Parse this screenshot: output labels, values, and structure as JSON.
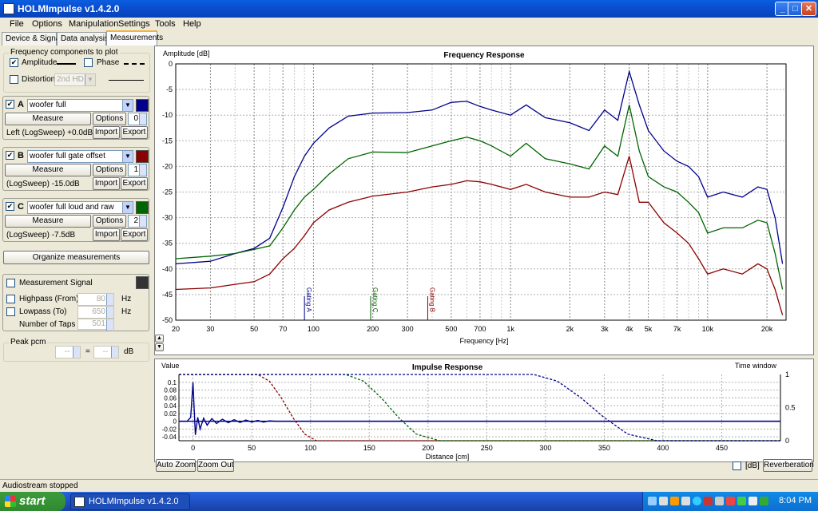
{
  "window": {
    "title": "HOLMImpulse  v1.4.2.0",
    "buttons": {
      "minimize": "_",
      "maximize": "□",
      "close": "✕"
    }
  },
  "menu": [
    "File",
    "Options",
    "Manipulation",
    "Settings",
    "Tools",
    "Help"
  ],
  "tabs": [
    {
      "label": "Device & Signal",
      "active": false
    },
    {
      "label": "Data analysis",
      "active": false
    },
    {
      "label": "Measurements",
      "active": true
    }
  ],
  "freq_components": {
    "group_label": "Frequency components to plot",
    "amplitude": {
      "label": "Amplitude",
      "checked": true
    },
    "phase": {
      "label": "Phase",
      "checked": false
    },
    "distortion": {
      "label": "Distortion",
      "checked": false,
      "select": "2nd HD"
    }
  },
  "measurements": [
    {
      "letter": "A",
      "checked": true,
      "name": "woofer full",
      "color": "#00008b",
      "measure": "Measure",
      "options": "Options",
      "spin": "0",
      "info": "Left (LogSweep) +0.0dB",
      "import": "Import",
      "export": "Export"
    },
    {
      "letter": "B",
      "checked": true,
      "name": "woofer full gate offset",
      "color": "#8b0000",
      "measure": "Measure",
      "options": "Options",
      "spin": "1",
      "info": "(LogSweep) -15.0dB",
      "import": "Import",
      "export": "Export"
    },
    {
      "letter": "C",
      "checked": true,
      "name": "woofer full loud and raw",
      "color": "#006400",
      "measure": "Measure",
      "options": "Options",
      "spin": "2",
      "info": "(LogSweep) -7.5dB",
      "import": "Import",
      "export": "Export"
    }
  ],
  "organize_button": "Organize measurements",
  "measurement_signal": {
    "label": "Measurement Signal",
    "checked": false,
    "highpass": {
      "label": "Highpass (From)",
      "value": "80",
      "unit": "Hz"
    },
    "lowpass": {
      "label": "Lowpass (To)",
      "value": "650",
      "unit": "Hz"
    },
    "taps": {
      "label": "Number of Taps",
      "value": "501"
    }
  },
  "peak": {
    "label": "Peak pcm",
    "left": "--",
    "equals": "=",
    "right": "--",
    "unit": "dB"
  },
  "chart_data": [
    {
      "type": "line",
      "title": "Frequency Response",
      "ylabel": "Amplitude [dB]",
      "xlabel": "Frequency [Hz]",
      "xscale": "log",
      "xlim": [
        20,
        25000
      ],
      "ylim": [
        -50,
        0
      ],
      "grid": true,
      "x_ticks": [
        20,
        30,
        50,
        70,
        100,
        200,
        300,
        500,
        700,
        1000,
        2000,
        3000,
        4000,
        5000,
        7000,
        10000,
        20000
      ],
      "x_tick_labels": [
        "20",
        "30",
        "50",
        "70",
        "100",
        "200",
        "300",
        "500",
        "700",
        "1k",
        "2k",
        "3k",
        "4k",
        "5k",
        "7k",
        "10k",
        "20k"
      ],
      "y_ticks": [
        0,
        -5,
        -10,
        -15,
        -20,
        -25,
        -30,
        -35,
        -40,
        -45,
        -50
      ],
      "markers": [
        {
          "x": 90,
          "label": "Gating A",
          "color": "#00008b"
        },
        {
          "x": 195,
          "label": "Gating C",
          "color": "#006400"
        },
        {
          "x": 380,
          "label": "Gating B",
          "color": "#8b0000"
        }
      ],
      "x": [
        20,
        30,
        40,
        50,
        60,
        70,
        80,
        90,
        100,
        120,
        150,
        200,
        300,
        400,
        500,
        600,
        700,
        800,
        1000,
        1200,
        1500,
        2000,
        2500,
        3000,
        3500,
        4000,
        4500,
        5000,
        6000,
        7000,
        8000,
        9000,
        10000,
        12000,
        15000,
        18000,
        20000,
        22000,
        24000
      ],
      "series": [
        {
          "name": "A",
          "color": "#00008b",
          "values": [
            -39,
            -38.5,
            -37,
            -36,
            -34,
            -28,
            -22,
            -18,
            -15.5,
            -12.5,
            -10.2,
            -9.6,
            -9.5,
            -9.0,
            -7.5,
            -7.3,
            -8.3,
            -9.0,
            -10.0,
            -8.0,
            -10.5,
            -11.5,
            -13,
            -9,
            -11,
            -1.5,
            -8,
            -13,
            -17,
            -19,
            -20,
            -22,
            -26,
            -25,
            -26,
            -24,
            -24.5,
            -30,
            -39
          ]
        },
        {
          "name": "B",
          "color": "#8b0000",
          "values": [
            -44,
            -43.7,
            -43,
            -42.5,
            -41,
            -38,
            -36,
            -33.5,
            -31,
            -28.5,
            -27,
            -25.8,
            -25,
            -24,
            -23.5,
            -22.8,
            -23.0,
            -23.5,
            -24.5,
            -23.5,
            -25,
            -26,
            -26,
            -25,
            -25.5,
            -18,
            -27,
            -27,
            -31,
            -33,
            -35,
            -38,
            -41,
            -40,
            -41,
            -39,
            -40,
            -44,
            -49
          ]
        },
        {
          "name": "C",
          "color": "#006400",
          "values": [
            -38,
            -37.5,
            -37,
            -36.2,
            -35.5,
            -32,
            -28.5,
            -26,
            -24.5,
            -21.5,
            -18.5,
            -17.2,
            -17.3,
            -16,
            -15,
            -14.3,
            -15,
            -16,
            -18,
            -15.5,
            -18.5,
            -19.5,
            -20.5,
            -16,
            -18,
            -8,
            -17,
            -22,
            -24,
            -25,
            -27,
            -29,
            -33,
            -32,
            -32,
            -30.5,
            -31,
            -37,
            -44
          ]
        }
      ]
    },
    {
      "type": "line",
      "title": "Impulse Response",
      "ylabel": "Value",
      "y2label": "Time window",
      "xlabel": "Distance [cm]",
      "xlim": [
        -12,
        500
      ],
      "ylim": [
        -0.05,
        0.12
      ],
      "y2lim": [
        0,
        1
      ],
      "grid": true,
      "x_ticks": [
        0,
        50,
        100,
        150,
        200,
        250,
        300,
        350,
        400,
        450
      ],
      "y_ticks": [
        0.1,
        0.08,
        0.06,
        0.04,
        0.02,
        0,
        -0.02,
        -0.04
      ],
      "y_tick_labels": [
        "0.1",
        "0.08",
        "0.06",
        "0.04",
        "0.02",
        "0",
        "-0.02",
        "-0.04"
      ],
      "y2_ticks": [
        1,
        0.5,
        0
      ],
      "impulse": {
        "x": [
          -12,
          -5,
          -2,
          0,
          1,
          2,
          4,
          6,
          9,
          12,
          16,
          20,
          25,
          30,
          35,
          40,
          45,
          50,
          55,
          60,
          65,
          70,
          80,
          90,
          100,
          200,
          300,
          400,
          480,
          500
        ],
        "values": [
          0,
          0,
          0.01,
          0.1,
          0.03,
          -0.035,
          0.01,
          -0.02,
          0.008,
          -0.01,
          0.007,
          -0.006,
          0.005,
          -0.004,
          0.004,
          -0.003,
          0.003,
          -0.002,
          0.002,
          -0.002,
          0.001,
          0,
          0,
          0,
          0,
          0,
          0,
          0,
          0,
          0
        ]
      },
      "windows": [
        {
          "name": "B",
          "color": "#8b0000",
          "x": [
            -12,
            55,
            65,
            75,
            85,
            95,
            105,
            500
          ],
          "values": [
            1,
            1,
            0.9,
            0.65,
            0.35,
            0.1,
            0,
            0
          ]
        },
        {
          "name": "C",
          "color": "#006400",
          "x": [
            -12,
            130,
            145,
            160,
            175,
            190,
            210,
            500
          ],
          "values": [
            1,
            1,
            0.9,
            0.65,
            0.35,
            0.1,
            0,
            0
          ]
        },
        {
          "name": "A",
          "color": "#00008b",
          "x": [
            -12,
            290,
            310,
            330,
            350,
            370,
            395,
            500
          ],
          "values": [
            1,
            1,
            0.9,
            0.65,
            0.35,
            0.1,
            0,
            0
          ]
        }
      ]
    }
  ],
  "impulse_controls": {
    "auto_zoom": "Auto Zoom",
    "zoom_out": "Zoom Out",
    "db_label": "[dB]",
    "db_checked": false,
    "reverberation": "Reverberation"
  },
  "status": "Audiostream stopped",
  "taskbar": {
    "start": "start",
    "task": "HOLMImpulse  v1.4.2.0",
    "clock": "8:04 PM"
  }
}
